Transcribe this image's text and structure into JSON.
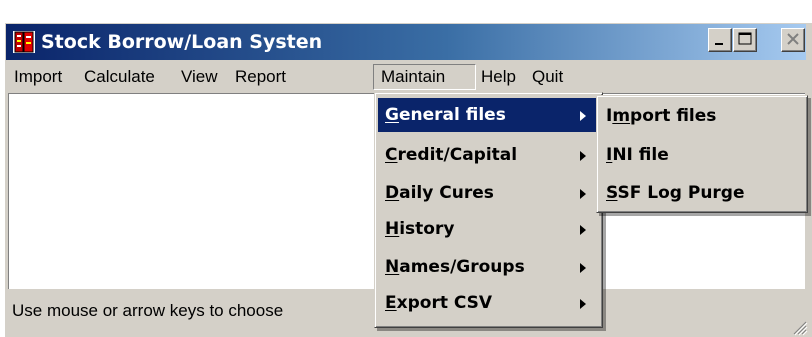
{
  "window": {
    "title": "Stock Borrow/Loan Systen",
    "icon": "stack-books-icon",
    "controls": [
      "minimize-icon",
      "maximize-icon",
      "close-icon"
    ],
    "title_gradient": [
      "#0a246a",
      "#a6caf0"
    ]
  },
  "menubar": {
    "items": [
      {
        "label": "Import"
      },
      {
        "label": "Calculate"
      },
      {
        "label": "View"
      },
      {
        "label": "Report"
      },
      {
        "label": "Maintain",
        "state": "open"
      },
      {
        "label": "Help"
      },
      {
        "label": "Quit"
      }
    ]
  },
  "maintain_menu": {
    "items": [
      {
        "mnemonic": "G",
        "rest": "eneral files",
        "submenu": true,
        "highlighted": true
      },
      {
        "mnemonic": "C",
        "rest": "redit/Capital",
        "submenu": true
      },
      {
        "mnemonic": "D",
        "rest": "aily Cures",
        "submenu": true
      },
      {
        "mnemonic": "H",
        "rest": "istory",
        "submenu": true
      },
      {
        "mnemonic": "N",
        "rest": "ames/Groups",
        "submenu": true
      },
      {
        "mnemonic": "E",
        "rest": "xport CSV",
        "submenu": true
      }
    ]
  },
  "general_files_submenu": {
    "items": [
      {
        "pre": "I",
        "mnemonic": "m",
        "rest": "port files"
      },
      {
        "pre": "",
        "mnemonic": "I",
        "rest": "NI file"
      },
      {
        "pre": "",
        "mnemonic": "S",
        "rest": "SF Log Purge"
      }
    ]
  },
  "statusbar": {
    "text": "Use mouse or arrow keys to choose"
  },
  "colors": {
    "face": "#d4d0c8",
    "highlight": "#0a246a",
    "client": "#ffffff"
  }
}
